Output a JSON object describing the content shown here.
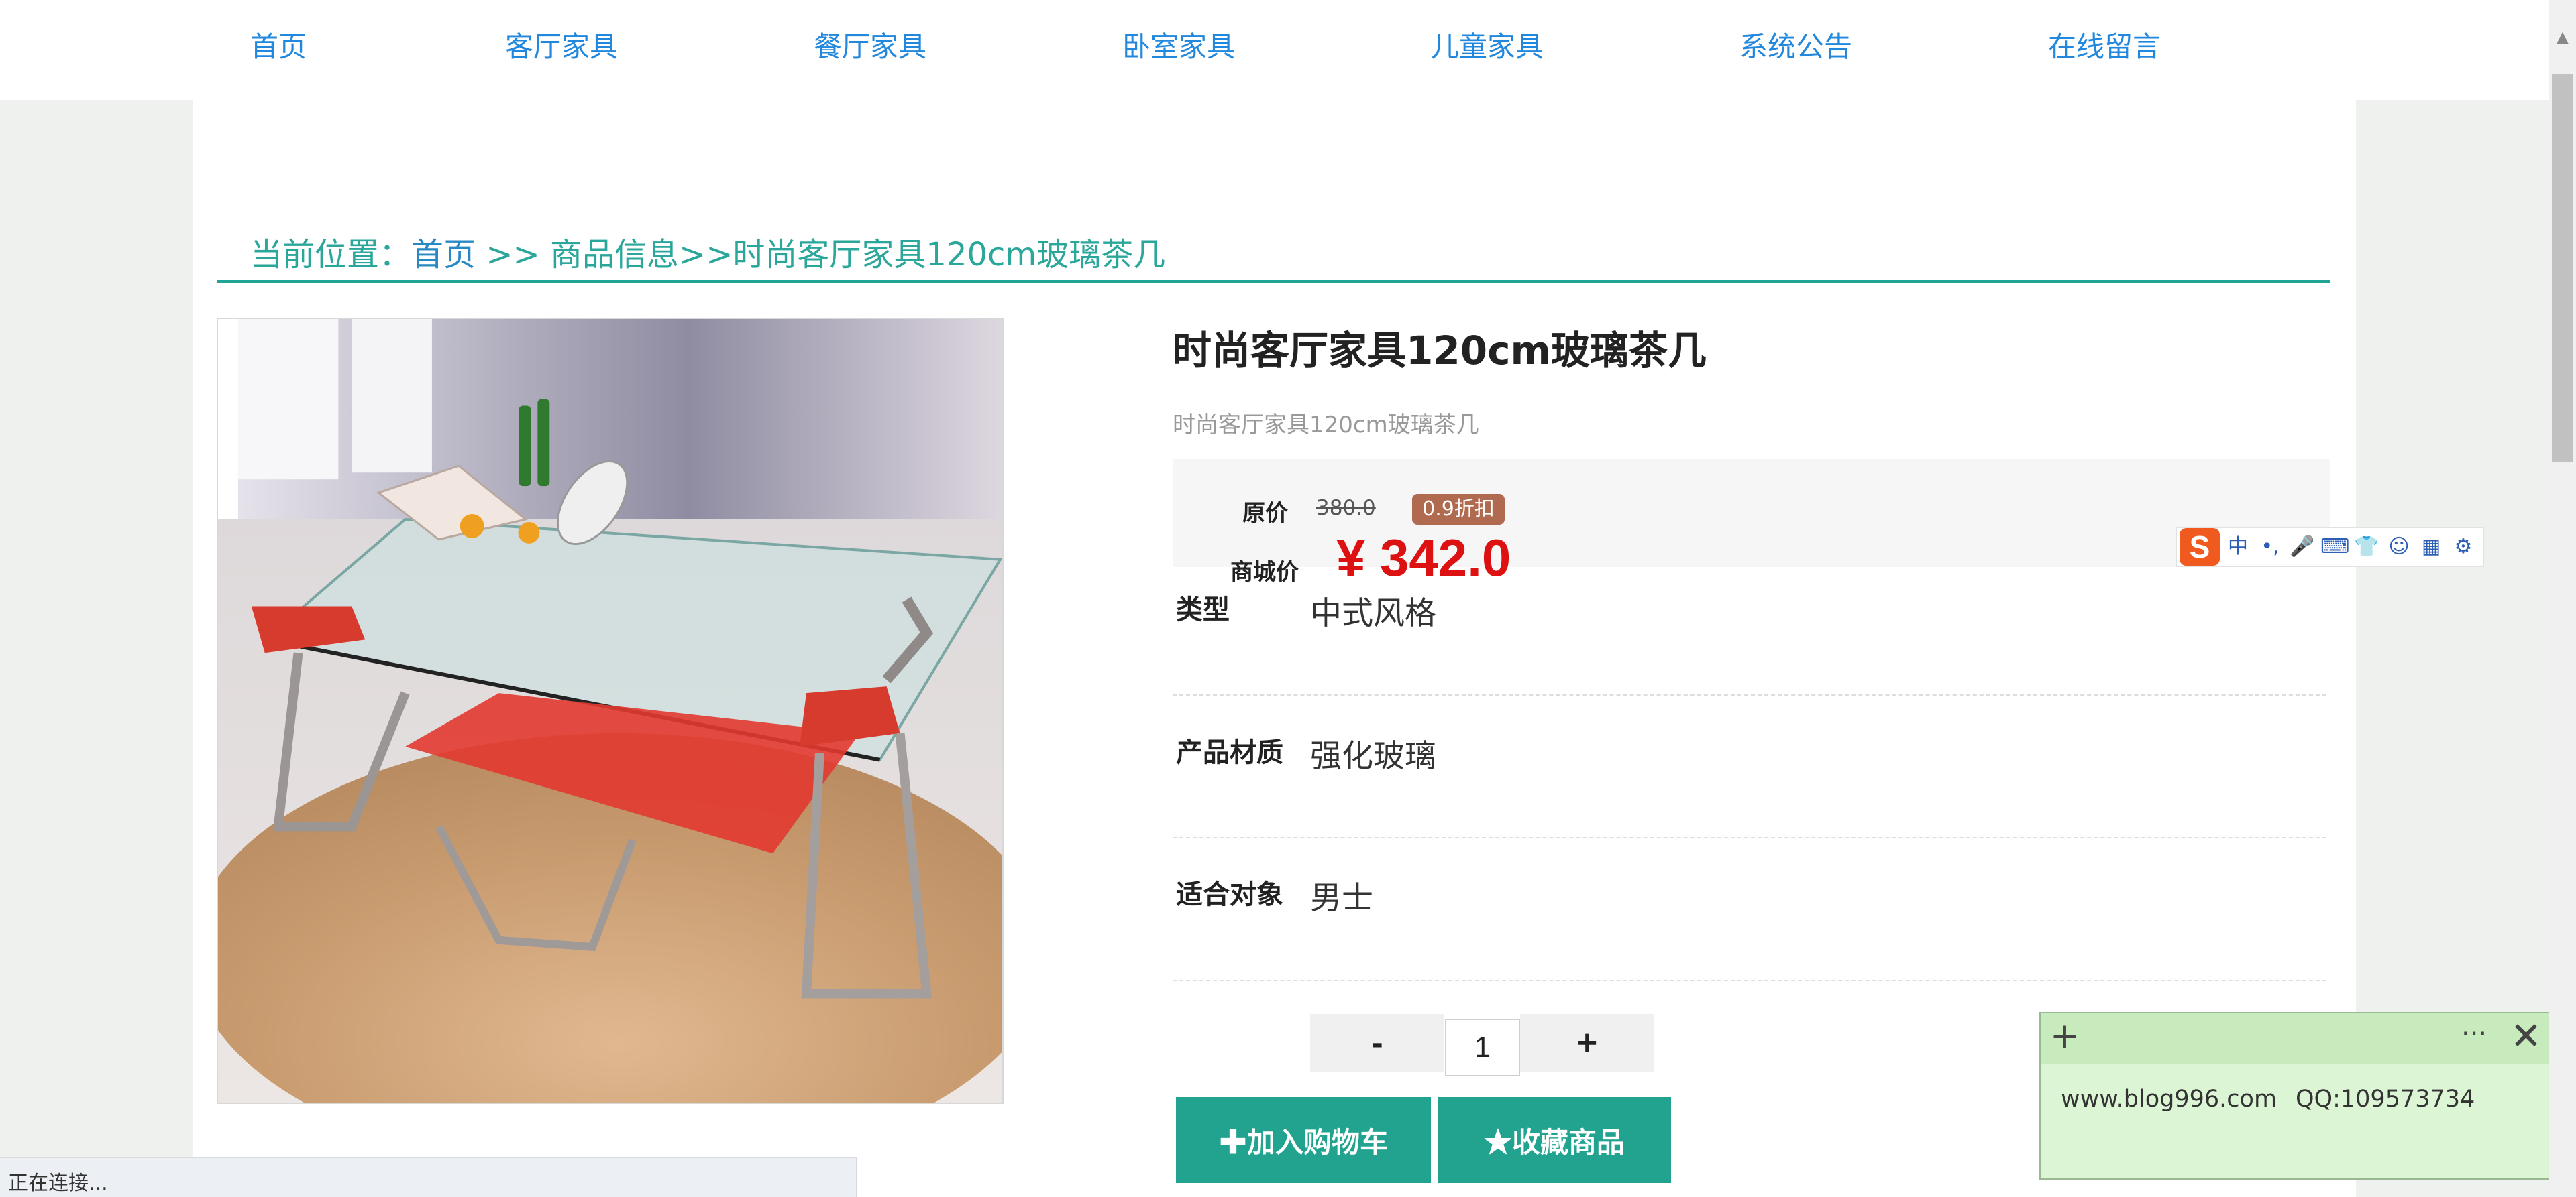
{
  "nav": {
    "items": [
      {
        "label": "首页"
      },
      {
        "label": "客厅家具"
      },
      {
        "label": "餐厅家具"
      },
      {
        "label": "卧室家具"
      },
      {
        "label": "儿童家具"
      },
      {
        "label": "系统公告"
      },
      {
        "label": "在线留言"
      }
    ]
  },
  "breadcrumb": {
    "prefix": "当前位置：",
    "home": "首页",
    "rest": " >> 商品信息>>时尚客厅家具120cm玻璃茶几"
  },
  "product": {
    "title": "时尚客厅家具120cm玻璃茶几",
    "subtitle": "时尚客厅家具120cm玻璃茶几",
    "original_label": "原价",
    "original_price": "380.0",
    "discount": "0.9折扣",
    "mall_label": "商城价",
    "mall_price": "¥ 342.0",
    "attributes": [
      {
        "label": "类型",
        "value": "中式风格"
      },
      {
        "label": "产品材质",
        "value": "强化玻璃"
      },
      {
        "label": "适合对象",
        "value": "男士"
      }
    ],
    "quantity": "1",
    "minus_label": "-",
    "plus_label": "+",
    "add_cart_label": "✚加入购物车",
    "favorite_label": "★收藏商品"
  },
  "ime": {
    "logo": "S",
    "items": [
      "中",
      "•,",
      "🎤",
      "⌨",
      "👕",
      "☺",
      "▦",
      "⚙"
    ]
  },
  "note": {
    "add": "+",
    "more": "···",
    "close": "✕",
    "site": "www.blog996.com",
    "qq": "QQ:109573734"
  },
  "status": {
    "text": "正在连接..."
  }
}
